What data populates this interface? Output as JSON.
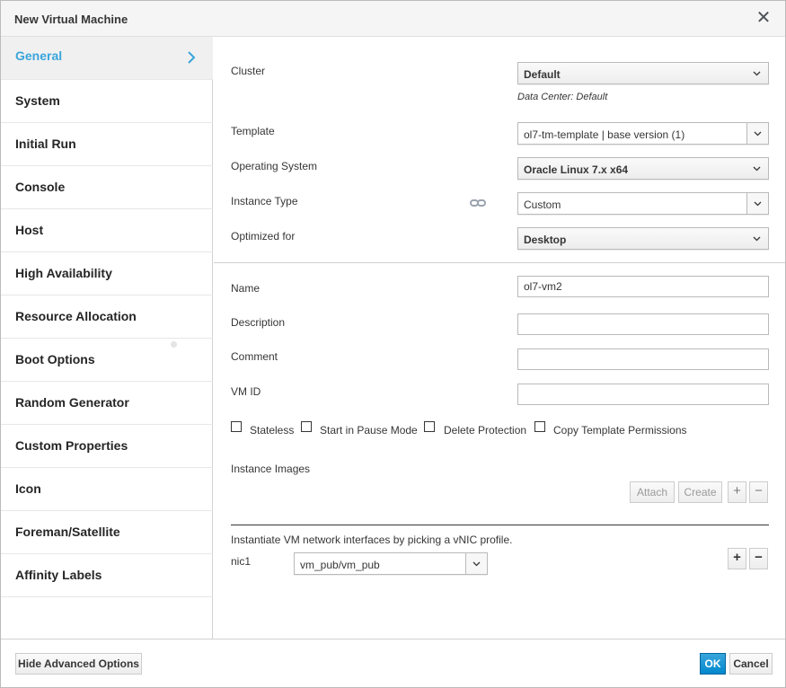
{
  "dialog": {
    "title": "New Virtual Machine",
    "close_glyph": "✕"
  },
  "sidebar": {
    "items": [
      {
        "label": "General",
        "active": true
      },
      {
        "label": "System"
      },
      {
        "label": "Initial Run"
      },
      {
        "label": "Console"
      },
      {
        "label": "Host"
      },
      {
        "label": "High Availability"
      },
      {
        "label": "Resource Allocation"
      },
      {
        "label": "Boot Options"
      },
      {
        "label": "Random Generator"
      },
      {
        "label": "Custom Properties"
      },
      {
        "label": "Icon"
      },
      {
        "label": "Foreman/Satellite"
      },
      {
        "label": "Affinity Labels"
      }
    ]
  },
  "form": {
    "cluster": {
      "label": "Cluster",
      "value": "Default",
      "hint": "Data Center: Default"
    },
    "template": {
      "label": "Template",
      "value": "ol7-tm-template | base version (1)"
    },
    "os": {
      "label": "Operating System",
      "value": "Oracle Linux 7.x x64"
    },
    "instance_type": {
      "label": "Instance Type",
      "value": "Custom"
    },
    "optimized": {
      "label": "Optimized for",
      "value": "Desktop"
    },
    "name": {
      "label": "Name",
      "value": "ol7-vm2"
    },
    "description": {
      "label": "Description",
      "value": ""
    },
    "comment": {
      "label": "Comment",
      "value": ""
    },
    "vm_id": {
      "label": "VM ID",
      "value": ""
    },
    "checkboxes": {
      "stateless": "Stateless",
      "pause": "Start in Pause Mode",
      "delete_protection": "Delete Protection",
      "copy_permissions": "Copy Template Permissions"
    },
    "instance_images": {
      "label": "Instance Images",
      "attach": "Attach",
      "create": "Create"
    },
    "network": {
      "intro": "Instantiate VM network interfaces by picking a vNIC profile.",
      "nic_label": "nic1",
      "nic_value": "vm_pub/vm_pub"
    },
    "plus": "+",
    "minus": "−"
  },
  "footer": {
    "hide_advanced": "Hide Advanced Options",
    "ok": "OK",
    "cancel": "Cancel"
  },
  "colors": {
    "accent": "#39a5dc",
    "primary_button": "#0088ce"
  }
}
